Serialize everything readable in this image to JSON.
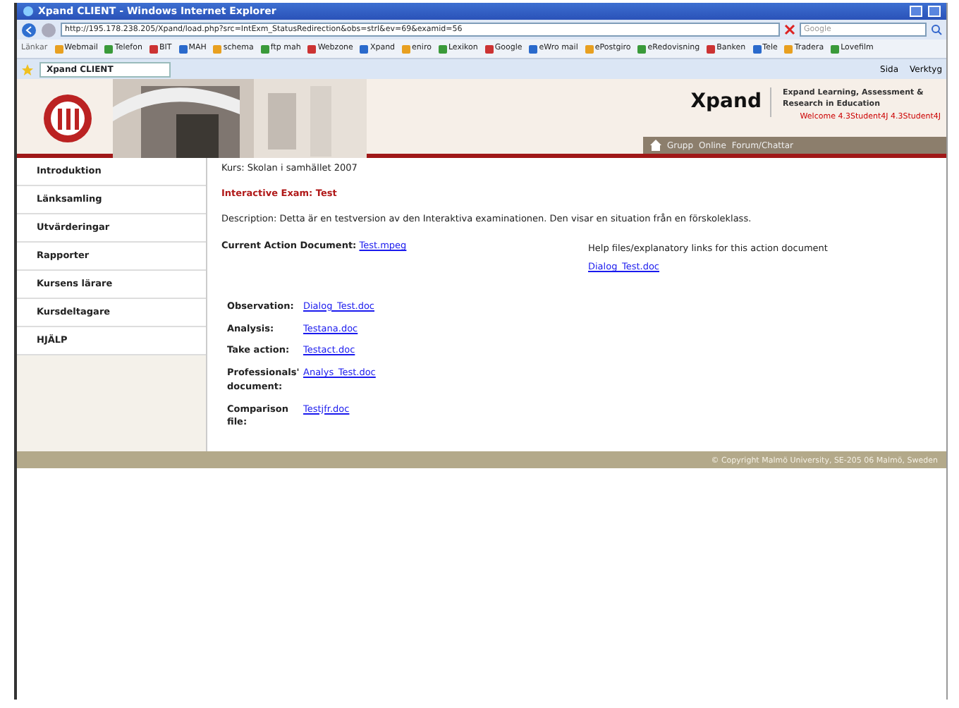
{
  "window": {
    "title": "Xpand CLIENT - Windows Internet Explorer"
  },
  "address_bar": {
    "url": "http://195.178.238.205/Xpand/load.php?src=IntExm_StatusRedirection&obs=strl&ev=69&examid=56",
    "search_placeholder": "Google"
  },
  "links_bar": {
    "label": "Länkar",
    "links": [
      "Webmail",
      "Telefon",
      "BIT",
      "MAH",
      "schema",
      "ftp mah",
      "Webzone",
      "Xpand",
      "eniro",
      "Lexikon",
      "Google",
      "eWro mail",
      "ePostgiro",
      "eRedovisning",
      "Banken",
      "Tele",
      "Tradera",
      "Lovefilm"
    ]
  },
  "browser_tabs": [
    {
      "label": "Xpand CLIENT",
      "selected": true
    }
  ],
  "command_bar": [
    "Sida",
    "Verktyg"
  ],
  "header": {
    "brand": "Xpand",
    "tagline": "Expand Learning, Assessment & Research in Education",
    "welcome": "Welcome 4.3Student4J 4.3Student4J",
    "nav": [
      "Grupp",
      "Online",
      "Forum/Chattar"
    ]
  },
  "sidebar": {
    "items": [
      {
        "label": "Introduktion"
      },
      {
        "label": "Länksamling"
      },
      {
        "label": "Utvärderingar"
      },
      {
        "label": "Rapporter"
      },
      {
        "label": "Kursens lärare"
      },
      {
        "label": "Kursdeltagare"
      },
      {
        "label": "HJÄLP"
      }
    ]
  },
  "content": {
    "course": "Kurs: Skolan i samhället 2007",
    "exam_title": "Interactive Exam: Test",
    "description": "Description: Detta är en testversion av den Interaktiva examinationen. Den visar en situation från en förskoleklass.",
    "current_label": "Current Action Document:",
    "current_link": "Test.mpeg",
    "help_text": "Help files/explanatory links for this action document",
    "help_link": "Dialog_Test.doc",
    "documents": [
      {
        "label": "Observation:",
        "link": "Dialog_Test.doc"
      },
      {
        "label": "Analysis:",
        "link": "Testana.doc"
      },
      {
        "label": "Take action:",
        "link": "Testact.doc"
      },
      {
        "label": "Professionals' document:",
        "link": "Analys_Test.doc"
      },
      {
        "label": "Comparison file:",
        "link": "Testjfr.doc"
      }
    ]
  },
  "footer": "© Copyright Malmö University, SE-205 06 Malmö, Sweden"
}
